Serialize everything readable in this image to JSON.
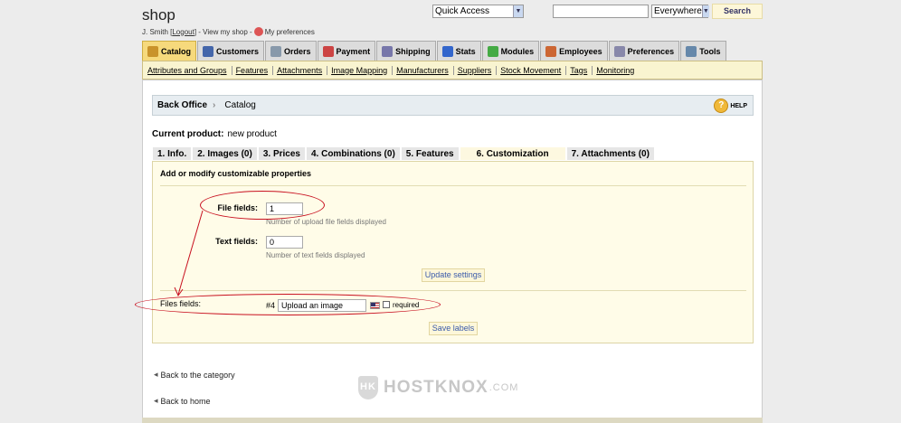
{
  "header": {
    "shop_title": "shop",
    "user": "J. Smith",
    "logout": "Logout",
    "view_shop": "View my shop",
    "prefs": "My preferences",
    "quick_access": "Quick Access",
    "search_scope": "Everywhere",
    "search_button": "Search",
    "search_value": ""
  },
  "tabs": [
    {
      "label": "Catalog",
      "icon": "catalog-icon",
      "color": "#c9932b"
    },
    {
      "label": "Customers",
      "icon": "customers-icon",
      "color": "#4466aa"
    },
    {
      "label": "Orders",
      "icon": "orders-icon",
      "color": "#8899aa"
    },
    {
      "label": "Payment",
      "icon": "payment-icon",
      "color": "#cc4444"
    },
    {
      "label": "Shipping",
      "icon": "shipping-icon",
      "color": "#7777aa"
    },
    {
      "label": "Stats",
      "icon": "stats-icon",
      "color": "#3366cc"
    },
    {
      "label": "Modules",
      "icon": "modules-icon",
      "color": "#44aa44"
    },
    {
      "label": "Employees",
      "icon": "employees-icon",
      "color": "#cc6633"
    },
    {
      "label": "Preferences",
      "icon": "preferences-icon",
      "color": "#8888aa"
    },
    {
      "label": "Tools",
      "icon": "tools-icon",
      "color": "#6688aa"
    }
  ],
  "subnav": [
    "Attributes and Groups",
    "Features",
    "Attachments",
    "Image Mapping",
    "Manufacturers",
    "Suppliers",
    "Stock Movement",
    "Tags",
    "Monitoring"
  ],
  "breadcrumb": {
    "root": "Back Office",
    "current": "Catalog",
    "help": "HELP"
  },
  "product": {
    "label": "Current product:",
    "value": "new product"
  },
  "product_tabs": [
    "1. Info.",
    "2. Images (0)",
    "3. Prices",
    "4. Combinations (0)",
    "5. Features",
    "6. Customization",
    "7. Attachments (0)"
  ],
  "form": {
    "heading": "Add or modify customizable properties",
    "file_label": "File fields:",
    "file_value": "1",
    "file_hint": "Number of upload file fields displayed",
    "text_label": "Text fields:",
    "text_value": "0",
    "text_hint": "Number of text fields displayed",
    "update_button": "Update settings",
    "files_label": "Files fields:",
    "field_number": "#4",
    "field_value": "Upload an image",
    "required_label": "required",
    "save_button": "Save labels"
  },
  "links": {
    "back_category": "Back to the category",
    "back_home": "Back to home"
  },
  "watermark": {
    "brand": "HOSTKNOX",
    "suffix": ".COM"
  }
}
